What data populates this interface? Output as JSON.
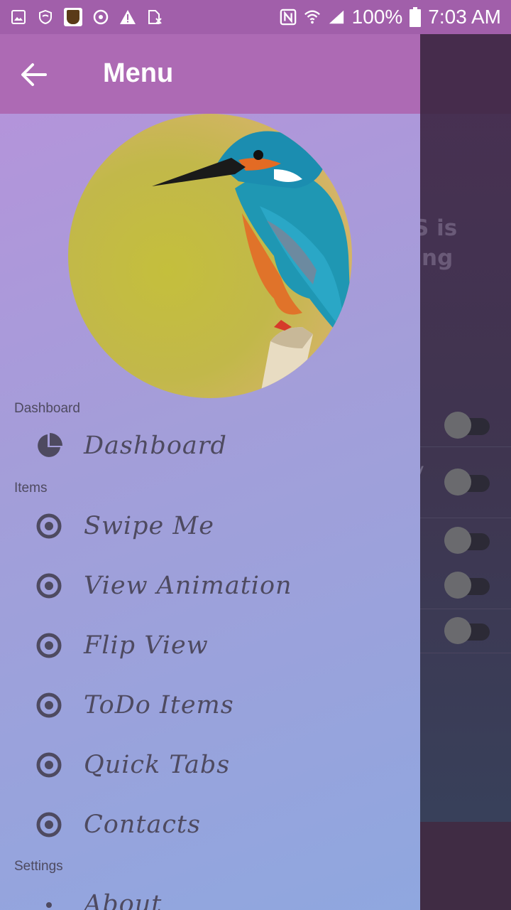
{
  "status_bar": {
    "battery": "100%",
    "time": "7:03 AM"
  },
  "drawer": {
    "title": "Menu",
    "sections": [
      {
        "label": "Dashboard"
      },
      {
        "label": "Items"
      },
      {
        "label": "Settings"
      }
    ],
    "items": [
      {
        "label": "Dashboard",
        "icon": "pie-chart-icon"
      },
      {
        "label": "Swipe Me",
        "icon": "radio-dot-icon"
      },
      {
        "label": "View Animation",
        "icon": "radio-dot-icon"
      },
      {
        "label": "Flip View",
        "icon": "radio-dot-icon"
      },
      {
        "label": "ToDo Items",
        "icon": "radio-dot-icon"
      },
      {
        "label": "Quick Tabs",
        "icon": "radio-dot-icon"
      },
      {
        "label": "Contacts",
        "icon": "radio-dot-icon"
      },
      {
        "label": "About",
        "icon": "info-icon"
      }
    ]
  },
  "background": {
    "heading_line1": "S is",
    "heading_line2": "ng",
    "row_text": "y"
  },
  "colors": {
    "status_bar": "#a15faa",
    "drawer_header": "#ad6ab4",
    "drawer_gradient_top": "#b792db",
    "drawer_gradient_bottom": "#8fa7df",
    "text": "#4e4a60"
  }
}
